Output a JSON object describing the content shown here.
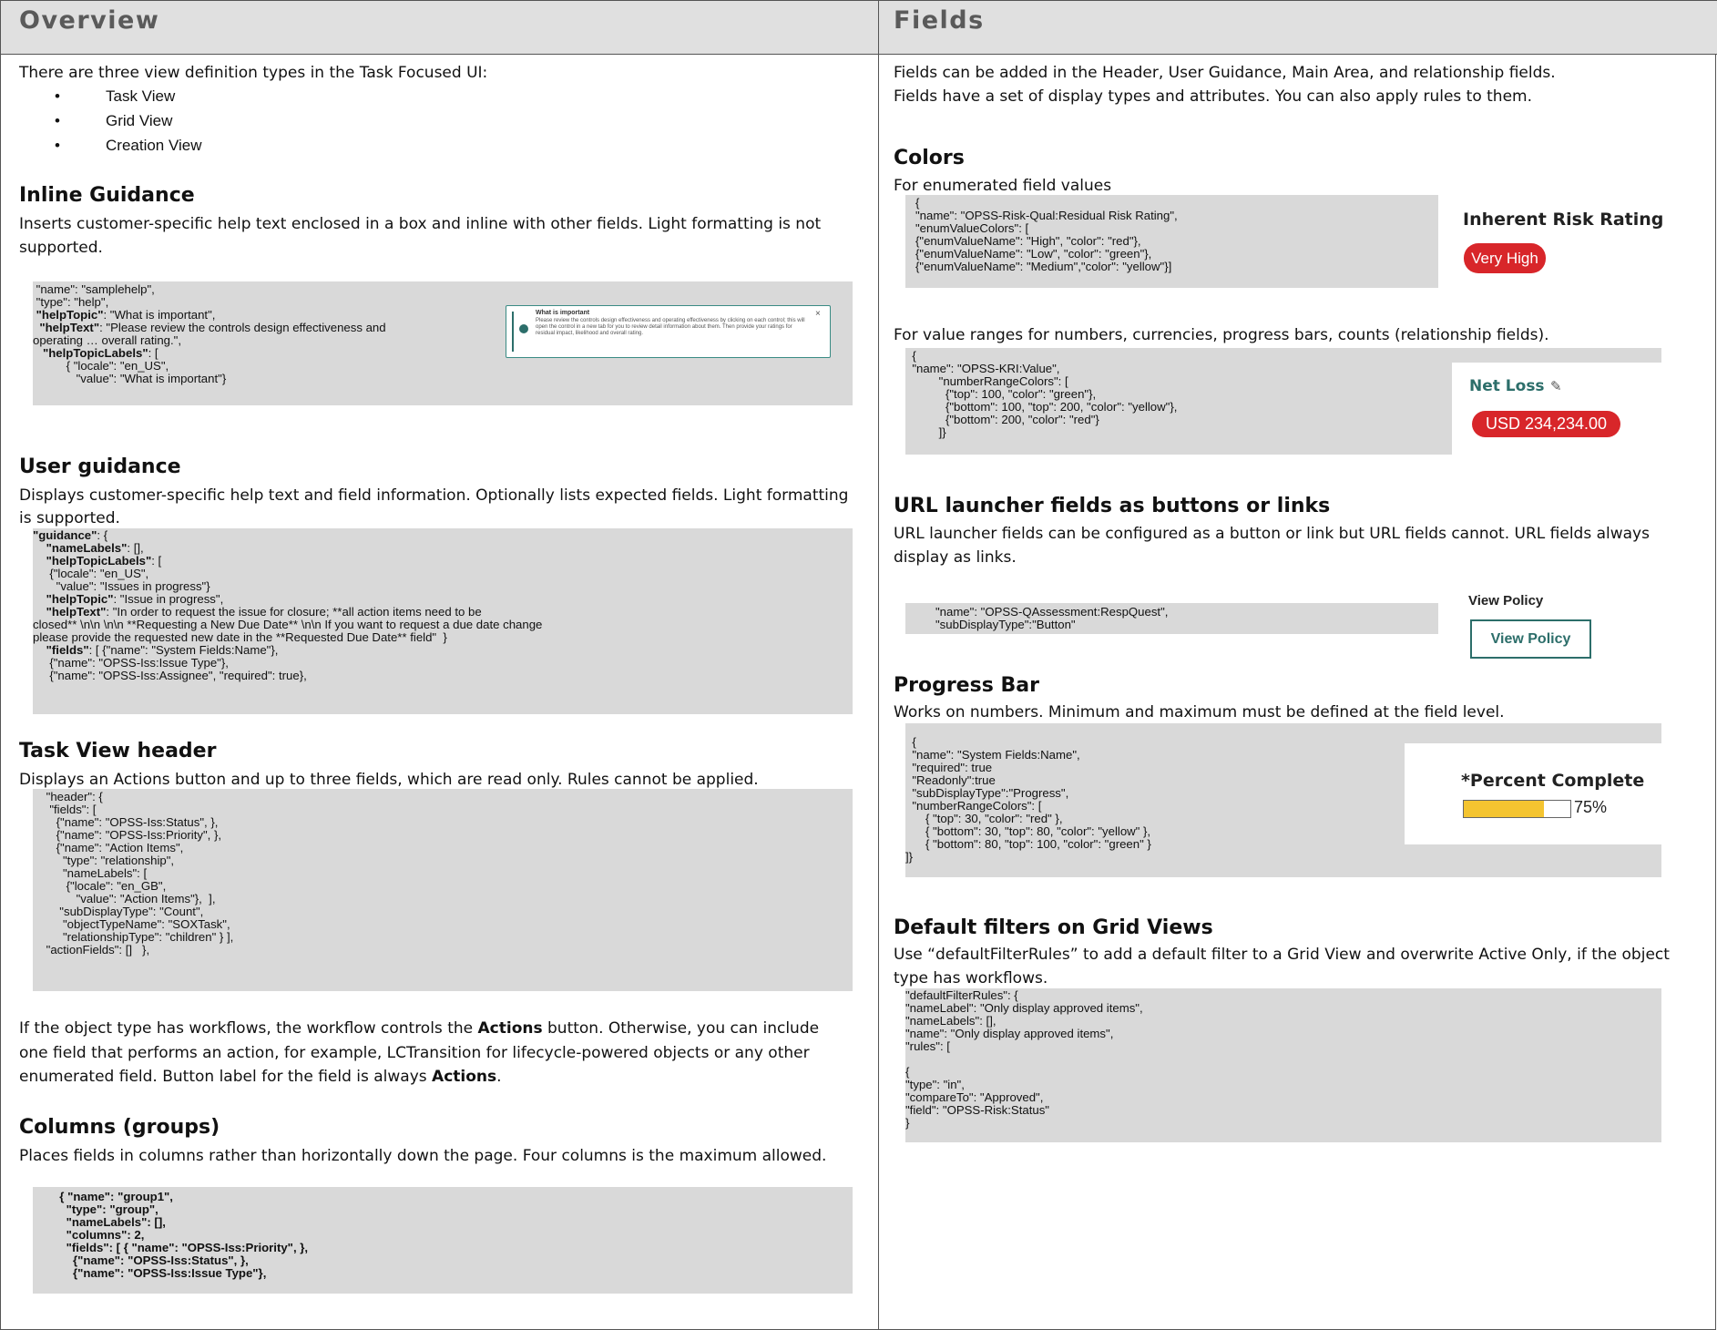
{
  "left": {
    "title": "Overview",
    "intro": "There are three view definition types in the Task Focused UI:",
    "view_types": [
      "Task View",
      "Grid View",
      "Creation View"
    ],
    "inline": {
      "heading": "Inline Guidance",
      "desc1": "Inserts customer-specific help text enclosed in a box and inline with other fields. Light formatting is not",
      "desc2": "supported.",
      "code": [
        {
          "t": " \"name\": \"samplehelp\","
        },
        {
          "t": " \"type\": \"help\","
        },
        {
          "t": " \"helpTopic\"",
          "b": true,
          "r": ": \"What is important\","
        },
        {
          "t": "  \"helpText\"",
          "b": true,
          "r": ": \"Please review the controls design effectiveness and"
        },
        {
          "t": "operating … overall rating.\","
        },
        {
          "t": "   \"helpTopicLabels\"",
          "b": true,
          "r": ": ["
        },
        {
          "t": "          { \"locale\": \"en_US\","
        },
        {
          "t": "             \"value\": \"What is important\"}"
        }
      ],
      "preview_title": "What is important",
      "preview_text": "Please review the controls design effectiveness and operating effectiveness by clicking on each control; this will open the control in a new tab for you to review detail information about them. Then provide your ratings for residual impact, likelihood and overall rating."
    },
    "user_guidance": {
      "heading": "User guidance",
      "desc1": "Displays customer-specific help text and field information. Optionally lists expected fields. Light formatting",
      "desc2": "is supported.",
      "code": [
        {
          "t": "\"guidance\"",
          "b": true,
          "r": ": {"
        },
        {
          "t": "    \"nameLabels\"",
          "b": true,
          "r": ": [],"
        },
        {
          "t": "    \"helpTopicLabels\"",
          "b": true,
          "r": ": ["
        },
        {
          "t": "     {\"locale\": \"en_US\","
        },
        {
          "t": "       \"value\": \"Issues in progress\"}"
        },
        {
          "t": "    \"helpTopic\"",
          "b": true,
          "r": ": \"Issue in progress\","
        },
        {
          "t": "    \"helpText\"",
          "b": true,
          "r": ": \"In order to request the issue for closure; **all action items need to be"
        },
        {
          "t": "closed** \\n\\n \\n\\n **Requesting a New Due Date** \\n\\n If you want to request a due date change"
        },
        {
          "t": "please provide the requested new date in the **Requested Due Date** field\"  }"
        },
        {
          "t": "    \"fields\"",
          "b": true,
          "r": ": [ {\"name\": \"System Fields:Name\"},"
        },
        {
          "t": "     {\"name\": \"OPSS-Iss:Issue Type\"},"
        },
        {
          "t": "     {\"name\": \"OPSS-Iss:Assignee\", \"required\": true},"
        }
      ]
    },
    "task_header": {
      "heading": "Task View header",
      "desc": "Displays an Actions button and up to three fields, which are read only. Rules cannot be applied.",
      "code": [
        {
          "t": "    \"header\": {"
        },
        {
          "t": "     \"fields\": ["
        },
        {
          "t": "       {\"name\": \"OPSS-Iss:Status\", },"
        },
        {
          "t": "       {\"name\": \"OPSS-Iss:Priority\", },"
        },
        {
          "t": "       {\"name\": \"Action Items\","
        },
        {
          "t": "         \"type\": \"relationship\","
        },
        {
          "t": "         \"nameLabels\": ["
        },
        {
          "t": "          {\"locale\": \"en_GB\","
        },
        {
          "t": "             \"value\": \"Action Items\"},  ],"
        },
        {
          "t": "        \"subDisplayType\": \"Count\","
        },
        {
          "t": "         \"objectTypeName\": \"SOXTask\","
        },
        {
          "t": "         \"relationshipType\": \"children\" } ],"
        },
        {
          "t": "    \"actionFields\": []   },"
        }
      ]
    },
    "workflow_p1_a": "If the object type has workflows, the workflow controls the ",
    "workflow_p1_b": "Actions",
    "workflow_p1_c": " button. Otherwise, you can include",
    "workflow_p2": "one field that performs an action, for example, LCTransition for lifecycle-powered objects or any other",
    "workflow_p3_a": "enumerated field. Button label for the field is always ",
    "workflow_p3_b": "Actions",
    "workflow_p3_c": ".",
    "columns": {
      "heading": "Columns (groups)",
      "desc": "Places fields in columns rather than horizontally down the page. Four columns is the maximum allowed.",
      "code": [
        {
          "t": "        { \"name\": \"group1\",",
          "b": true
        },
        {
          "t": "          \"type\": \"group\",",
          "b": true
        },
        {
          "t": "          \"nameLabels\": [],",
          "b": true
        },
        {
          "t": "          \"columns\": 2,",
          "b": true
        },
        {
          "t": "          \"fields\": [ { \"name\": \"OPSS-Iss:Priority\", },",
          "b": true
        },
        {
          "t": "            {\"name\": \"OPSS-Iss:Status\", },",
          "b": true
        },
        {
          "t": "            {\"name\": \"OPSS-Iss:Issue Type\"},",
          "b": true
        }
      ]
    }
  },
  "right": {
    "title": "Fields",
    "intro1": "Fields can be added in the Header, User Guidance, Main Area, and relationship fields.",
    "intro2": "Fields have a set of display types and attributes. You can also apply rules to them.",
    "colors": {
      "heading": "Colors",
      "sub": "For enumerated field values",
      "code": [
        {
          "t": "   {"
        },
        {
          "t": "   \"name\": \"OPSS-Risk-Qual:Residual Risk Rating\","
        },
        {
          "t": "   \"enumValueColors\": ["
        },
        {
          "t": "   {\"enumValueName\": \"High\", \"color\": \"red\"},"
        },
        {
          "t": "   {\"enumValueName\": \"Low\", \"color\": \"green\"},"
        },
        {
          "t": "   {\"enumValueName\": \"Medium\",\"color\": \"yellow\"}]"
        }
      ],
      "preview_label": "Inherent Risk Rating",
      "preview_value": "Very High",
      "range_sub": "For value ranges for numbers, currencies, progress bars, counts (relationship fields).",
      "range_code": [
        {
          "t": "  {"
        },
        {
          "t": "  \"name\": \"OPSS-KRI:Value\","
        },
        {
          "t": "          \"numberRangeColors\": ["
        },
        {
          "t": "            {\"top\": 100, \"color\": \"green\"},"
        },
        {
          "t": "            {\"bottom\": 100, \"top\": 200, \"color\": \"yellow\"},"
        },
        {
          "t": "            {\"bottom\": 200, \"color\": \"red\"}"
        },
        {
          "t": "          ]}"
        }
      ],
      "range_label": "Net Loss",
      "range_value": "USD 234,234.00"
    },
    "url": {
      "heading": "URL launcher fields as buttons or links",
      "desc1": "URL launcher fields can be configured as a button or link but URL fields cannot. URL fields always",
      "desc2": "display as links.",
      "code": [
        {
          "t": "         \"name\": \"OPSS-QAssessment:RespQuest\","
        },
        {
          "t": "         \"subDisplayType\":\"Button\""
        }
      ],
      "preview_label": "View Policy",
      "button_label": "View Policy"
    },
    "progress": {
      "heading": "Progress Bar",
      "desc": "Works on numbers. Minimum and maximum must be defined at the field level.",
      "code": [
        {
          "t": "  {"
        },
        {
          "t": "  \"name\": \"System Fields:Name\","
        },
        {
          "t": "  \"required\": true"
        },
        {
          "t": "  \"Readonly\":true"
        },
        {
          "t": "  \"subDisplayType\":\"Progress\","
        },
        {
          "t": "  \"numberRangeColors\": ["
        },
        {
          "t": "      { \"top\": 30, \"color\": \"red\" },"
        },
        {
          "t": "      { \"bottom\": 30, \"top\": 80, \"color\": \"yellow\" },"
        },
        {
          "t": "      { \"bottom\": 80, \"top\": 100, \"color\": \"green\" }"
        },
        {
          "t": "]}"
        }
      ],
      "preview_label": "*Percent Complete",
      "percent_text": "75%",
      "percent": 0.75
    },
    "filters": {
      "heading": "Default filters on Grid Views",
      "desc1": "Use “defaultFilterRules” to add a default filter to a Grid View and overwrite Active Only, if the object",
      "desc2": "type has workflows.",
      "code": [
        {
          "t": "\"defaultFilterRules\": {"
        },
        {
          "t": "\"nameLabel\": \"Only display approved items\","
        },
        {
          "t": "\"nameLabels\": [],"
        },
        {
          "t": "\"name\": \"Only display approved items\","
        },
        {
          "t": "\"rules\": ["
        },
        {
          "t": ""
        },
        {
          "t": "{"
        },
        {
          "t": "\"type\": \"in\","
        },
        {
          "t": "\"compareTo\": \"Approved\","
        },
        {
          "t": "\"field\": \"OPSS-Risk:Status\""
        },
        {
          "t": "}"
        }
      ]
    }
  },
  "colors": {
    "header_bg": "#e0e0e0",
    "code_bg": "#d9d9d9",
    "pill_red": "#d8262a",
    "teal": "#2c6e6a",
    "progress_yellow": "#f4c430"
  }
}
